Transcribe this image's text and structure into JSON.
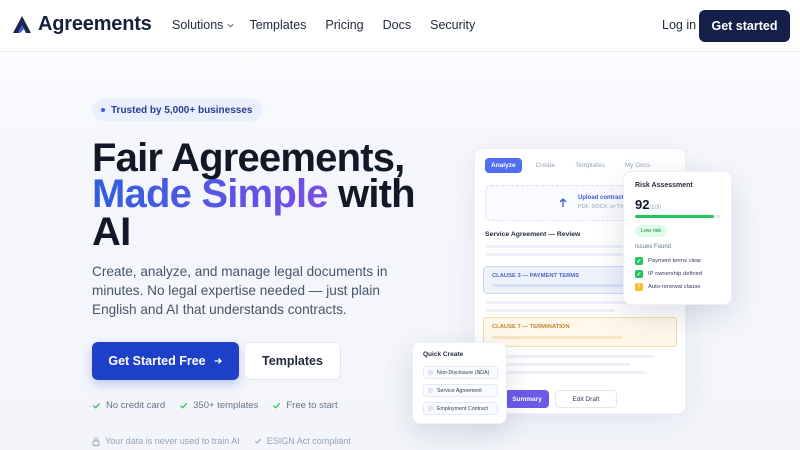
{
  "brand": {
    "name": "Agreements"
  },
  "nav": {
    "links": [
      "Solutions",
      "Templates",
      "Pricing",
      "Docs",
      "Security"
    ],
    "login": "Log in",
    "cta": "Get started"
  },
  "hero": {
    "badge": "Trusted by 5,000+ businesses",
    "title_line1": "Fair Agreements,",
    "title_highlight": "Made Simple",
    "title_after_highlight": " with",
    "title_line3": "AI",
    "subtitle": "Create, analyze, and manage legal documents in minutes. No legal expertise needed — just plain English and AI that understands contracts.",
    "primary_button": "Get Started Free",
    "secondary_button": "Templates",
    "checks": [
      "No credit card",
      "350+ templates",
      "Free to start"
    ],
    "trust": [
      "Your data is never used to train AI",
      "ESIGN Act compliant"
    ]
  },
  "mockup": {
    "tabs": [
      "Analyze",
      "Create",
      "Templates",
      "My Docs"
    ],
    "active_tab": "Analyze",
    "upload_title": "Upload contract",
    "upload_sub": "PDF, DOCX, or TXT",
    "doc_title": "Service Agreement — Review",
    "clause_blue": "CLAUSE 3 — PAYMENT TERMS",
    "clause_yellow": "CLAUSE 7 — TERMINATION",
    "button_primary": "Summary",
    "button_secondary": "Edit Draft"
  },
  "risk": {
    "title": "Risk Assessment",
    "score": "92",
    "score_of": "/100",
    "score_fraction": 0.92,
    "badge": "Low risk",
    "issues_title": "Issues Found",
    "issues": [
      {
        "label": "Payment terms clear",
        "status": "ok"
      },
      {
        "label": "IP ownership defined",
        "status": "ok"
      },
      {
        "label": "Auto-renewal clause",
        "status": "warn"
      }
    ]
  },
  "quick_create": {
    "title": "Quick Create",
    "items": [
      "Non-Disclosure (NDA)",
      "Service Agreement",
      "Employment Contract"
    ]
  },
  "colors": {
    "brand_dark": "#15204a",
    "primary": "#1d40c8",
    "gradient_start": "#2f5fe0",
    "gradient_end": "#7a4de8",
    "success": "#22c55e",
    "warning": "#fbbf24"
  }
}
